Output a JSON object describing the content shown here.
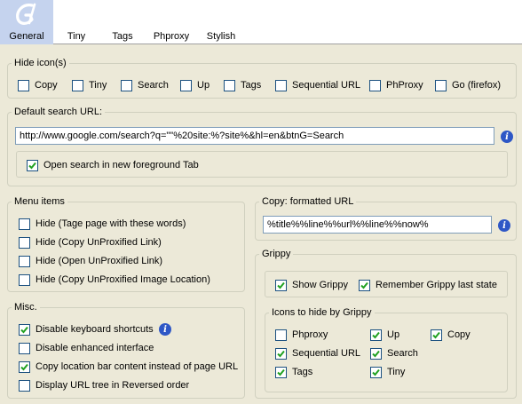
{
  "tabs": [
    {
      "label": "General",
      "active": true
    },
    {
      "label": "Tiny"
    },
    {
      "label": "Tags"
    },
    {
      "label": "Phproxy"
    },
    {
      "label": "Stylish"
    }
  ],
  "hide_icons": {
    "legend": "Hide icon(s)",
    "items": [
      {
        "label": "Copy",
        "checked": false
      },
      {
        "label": "Tiny",
        "checked": false
      },
      {
        "label": "Search",
        "checked": false
      },
      {
        "label": "Up",
        "checked": false
      },
      {
        "label": "Tags",
        "checked": false
      },
      {
        "label": "Sequential URL",
        "checked": false
      },
      {
        "label": "PhProxy",
        "checked": false
      },
      {
        "label": "Go (firefox)",
        "checked": false
      }
    ]
  },
  "default_search": {
    "legend": "Default search URL:",
    "url": "http://www.google.com/search?q=\"\"%20site:%?site%&hl=en&btnG=Search",
    "open_new_tab_label": "Open search in new foreground Tab",
    "open_new_tab_checked": true
  },
  "menu_items": {
    "legend": "Menu items",
    "items": [
      {
        "label": "Hide (Tage page with these words)",
        "checked": false
      },
      {
        "label": "Hide (Copy UnProxified Link)",
        "checked": false
      },
      {
        "label": "Hide (Open UnProxified Link)",
        "checked": false
      },
      {
        "label": "Hide (Copy UnProxified Image Location)",
        "checked": false
      }
    ]
  },
  "misc": {
    "legend": "Misc.",
    "items": [
      {
        "label": "Disable keyboard shortcuts",
        "checked": true
      },
      {
        "label": "Disable enhanced interface",
        "checked": false
      },
      {
        "label": "Copy location bar content instead of page URL",
        "checked": true
      },
      {
        "label": "Display URL tree in Reversed order",
        "checked": false
      }
    ]
  },
  "copy_formatted": {
    "legend": "Copy: formatted URL",
    "value": "%title%%line%%url%%line%%now%"
  },
  "grippy": {
    "legend": "Grippy",
    "show_label": "Show Grippy",
    "show_checked": true,
    "remember_label": "Remember Grippy last state",
    "remember_checked": true,
    "icons_legend": "Icons to hide by Grippy",
    "icons": [
      {
        "label": "Phproxy",
        "checked": false
      },
      {
        "label": "Up",
        "checked": true
      },
      {
        "label": "Copy",
        "checked": true
      },
      {
        "label": "Sequential URL",
        "checked": true
      },
      {
        "label": "Search",
        "checked": true
      },
      {
        "label": "Tags",
        "checked": true
      },
      {
        "label": "Tiny",
        "checked": true
      }
    ]
  },
  "colors": {
    "accent": "#2e57c6",
    "active_tab": "#c5d3ee",
    "check": "#21a121"
  }
}
